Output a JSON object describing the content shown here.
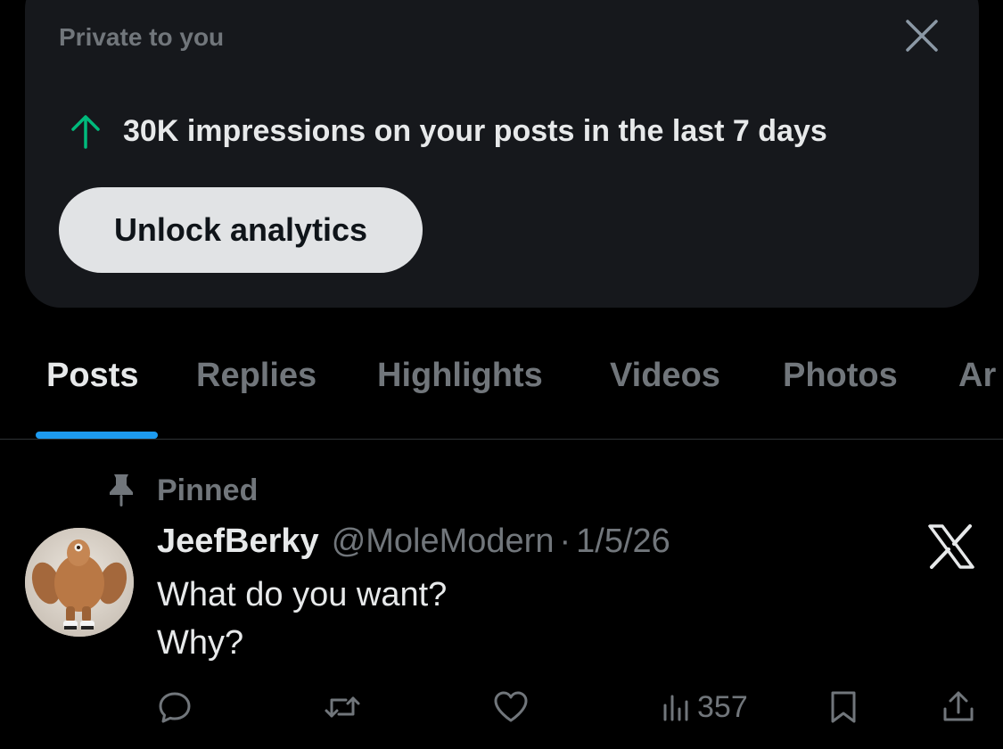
{
  "analytics_card": {
    "title": "Private to you",
    "stat_text": "30K impressions on your posts in the last 7 days",
    "button_label": "Unlock analytics"
  },
  "tabs": [
    {
      "label": "Posts",
      "active": true
    },
    {
      "label": "Replies",
      "active": false
    },
    {
      "label": "Highlights",
      "active": false
    },
    {
      "label": "Videos",
      "active": false
    },
    {
      "label": "Photos",
      "active": false
    },
    {
      "label": "Articles",
      "active": false
    }
  ],
  "tab_visible_labels": {
    "posts": "Posts",
    "replies": "Replies",
    "highlights": "Highlights",
    "videos": "Videos",
    "photos": "Photos",
    "articles_partial": "Ar"
  },
  "post": {
    "pinned_label": "Pinned",
    "author_name": "JeefBerky",
    "author_handle": "@MoleModern",
    "separator": "·",
    "date": "1/5/26",
    "text_lines": [
      "What do you want?",
      "Why?"
    ],
    "views": "357"
  },
  "icons": {
    "close": "close-icon",
    "up_arrow": "arrow-up-icon",
    "pin": "pin-icon",
    "x_logo": "x-logo-icon",
    "reply": "reply-icon",
    "repost": "repost-icon",
    "like": "heart-icon",
    "views": "views-icon",
    "bookmark": "bookmark-icon",
    "share": "share-icon"
  },
  "colors": {
    "background": "#000000",
    "card": "#16181c",
    "accent": "#1d9bf0",
    "up_arrow": "#00ba7c",
    "muted_text": "#71767b",
    "primary_text": "#e7e9ea",
    "button_bg": "#e1e3e5"
  }
}
